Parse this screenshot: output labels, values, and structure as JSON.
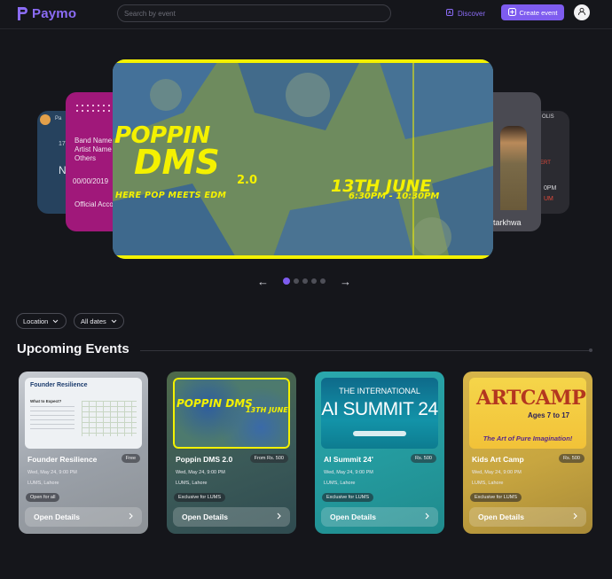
{
  "header": {
    "app_name": "Paymo",
    "search_placeholder": "Search by event",
    "discover_label": "Discover",
    "create_label": "Create event",
    "colors": {
      "brand": "#8b6cf6",
      "button": "#7e5cef",
      "background": "#15161b"
    }
  },
  "carousel": {
    "main": {
      "title": "POPPIN",
      "title2": "DMS",
      "version": "2.0",
      "tagline": "HERE POP MEETS EDM",
      "date": "13TH JUNE",
      "time": "6:30PM - 10:30PM"
    },
    "left_card": {
      "lines": [
        "Band Name",
        "Artist Name",
        "Others",
        "00/00/2019",
        "Official Acco"
      ]
    },
    "far_left_card": {
      "lines": [
        "Pa",
        "17",
        "N"
      ]
    },
    "right_card": {
      "lines": [
        "tarkhwa"
      ]
    },
    "far_right_card": {
      "lines": [
        "OLIS",
        "ERT",
        "0PM",
        "UM"
      ]
    },
    "slide_count": 5,
    "active_slide": 1
  },
  "filters": {
    "location_label": "Location",
    "dates_label": "All dates"
  },
  "section": {
    "title": "Upcoming Events"
  },
  "events": [
    {
      "title": "Founder Resilience",
      "price": "Free",
      "date": "Wed, May 24, 9:00 PM",
      "location": "LUMS, Lahore",
      "access": "Open for all",
      "cta": "Open Details",
      "thumb_title": "Founder Resilience",
      "thumb_sub": "What to Expect?"
    },
    {
      "title": "Poppin DMS 2.0",
      "price": "From Rs. 500",
      "date": "Wed, May 24, 9:00 PM",
      "location": "LUMS, Lahore",
      "access": "Exclusive for LUMS",
      "cta": "Open Details",
      "thumb_title": "POPPIN DMS",
      "thumb_sub": "13TH JUNE"
    },
    {
      "title": "AI Summit 24'",
      "price": "Rs. 500",
      "date": "Wed, May 24, 9:00 PM",
      "location": "LUMS, Lahore",
      "access": "Exclusive for LUMS",
      "cta": "Open Details",
      "thumb_title": "THE INTERNATIONAL",
      "thumb_sub": "AI SUMMIT 24"
    },
    {
      "title": "Kids Art Camp",
      "price": "Rs. 500",
      "date": "Wed, May 24, 9:00 PM",
      "location": "LUMS, Lahore",
      "access": "Exclusive for LUMS",
      "cta": "Open Details",
      "thumb_title": "ARTCAMP",
      "thumb_sub": "Ages 7 to 17",
      "thumb_tag": "The Art of Pure Imagination!"
    }
  ]
}
